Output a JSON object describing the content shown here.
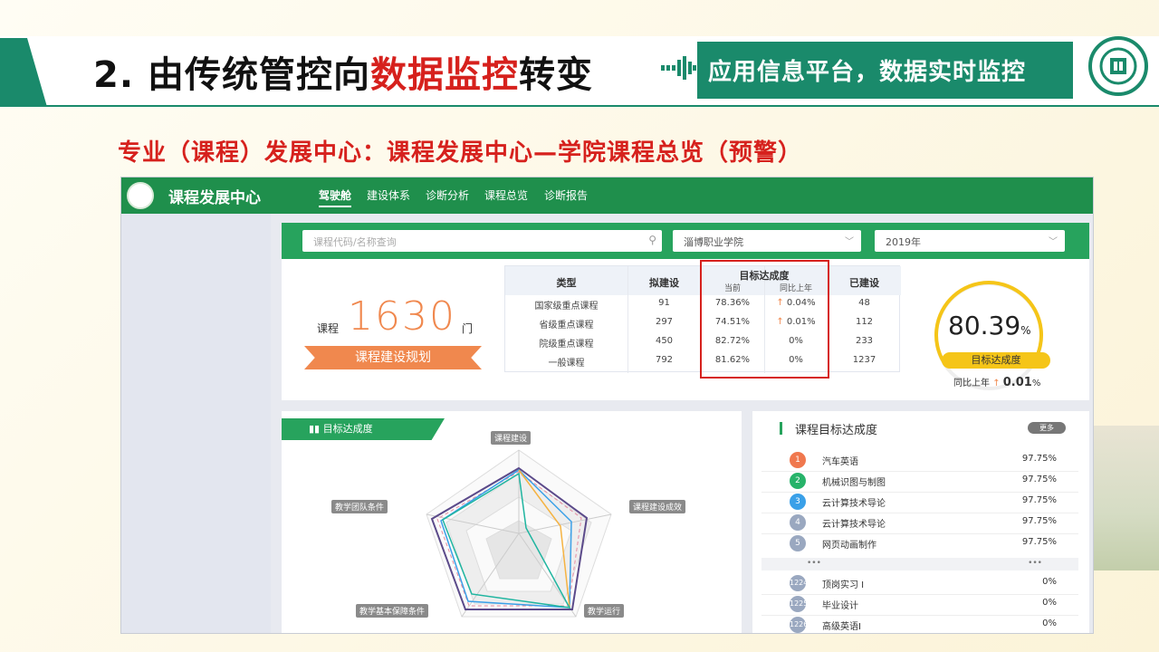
{
  "slide": {
    "title_prefix": "2. 由传统管控向",
    "title_highlight": "数据监控",
    "title_suffix": "转变",
    "badge": "应用信息平台，数据实时监控",
    "subtitle": "专业（课程）发展中心：课程发展中心—学院课程总览（预警）"
  },
  "app": {
    "brand": "课程发展中心",
    "nav": [
      "驾驶舱",
      "建设体系",
      "诊断分析",
      "课程总览",
      "诊断报告"
    ],
    "search_placeholder": "课程代码/名称查询",
    "college_select": "淄博职业学院",
    "year_select": "2019年",
    "course_count_prefix": "课程",
    "course_count": "1630",
    "course_count_unit": "门",
    "plan_button": "课程建设规划",
    "table": {
      "h_type": "类型",
      "h_planned": "拟建设",
      "h_target": "目标达成度",
      "h_current": "当前",
      "h_yoy": "同比上年",
      "h_built": "已建设",
      "rows": [
        {
          "type": "国家级重点课程",
          "planned": "91",
          "current": "78.36%",
          "yoy": "0.04%",
          "yoy_up": true,
          "built": "48"
        },
        {
          "type": "省级重点课程",
          "planned": "297",
          "current": "74.51%",
          "yoy": "0.01%",
          "yoy_up": true,
          "built": "112"
        },
        {
          "type": "院级重点课程",
          "planned": "450",
          "current": "82.72%",
          "yoy": "0%",
          "yoy_up": false,
          "built": "233"
        },
        {
          "type": "一般课程",
          "planned": "792",
          "current": "81.62%",
          "yoy": "0%",
          "yoy_up": false,
          "built": "1237"
        }
      ]
    },
    "gauge": {
      "value": "80.39",
      "unit": "%",
      "label": "目标达成度",
      "yoy_prefix": "同比上年",
      "yoy_value": "0.01",
      "yoy_unit": "%"
    },
    "radar": {
      "tab": "目标达成度",
      "axes": [
        "课程建设",
        "课程建设成效",
        "教学运行",
        "教学基本保障条件",
        "教学团队条件"
      ]
    },
    "ranking": {
      "title": "课程目标达成度",
      "more": "更多",
      "top": [
        {
          "rank": "1",
          "name": "汽车英语",
          "value": "97.75%",
          "color": "#f0784e"
        },
        {
          "rank": "2",
          "name": "机械识图与制图",
          "value": "97.75%",
          "color": "#27b36a"
        },
        {
          "rank": "3",
          "name": "云计算技术导论",
          "value": "97.75%",
          "color": "#3aa0e8"
        },
        {
          "rank": "4",
          "name": "云计算技术导论",
          "value": "97.75%",
          "color": "#9aa8c0"
        },
        {
          "rank": "5",
          "name": "网页动画制作",
          "value": "97.75%",
          "color": "#9aa8c0"
        }
      ],
      "ellipsis": "•••",
      "bottom": [
        {
          "rank": "1224",
          "name": "顶岗实习 I",
          "value": "0%"
        },
        {
          "rank": "1225",
          "name": "毕业设计",
          "value": "0%"
        },
        {
          "rank": "1226",
          "name": "高级英语I",
          "value": "0%"
        }
      ]
    }
  }
}
